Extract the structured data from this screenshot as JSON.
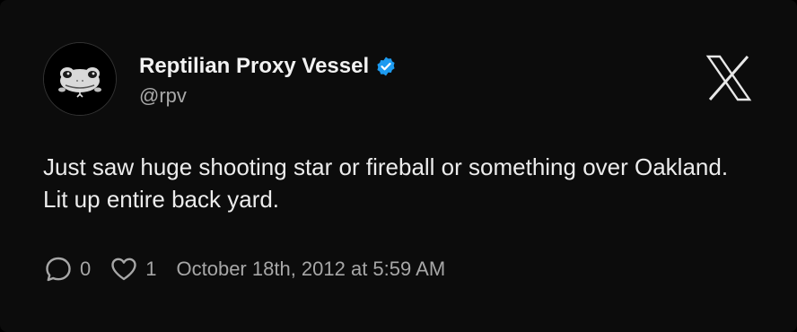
{
  "author": {
    "display_name": "Reptilian Proxy Vessel",
    "handle": "@rpv",
    "verified": true,
    "verified_color": "#1d9bf0",
    "avatar_icon": "lizard-face-icon"
  },
  "platform_logo": "x-logo-icon",
  "tweet": {
    "text": "Just saw huge shooting star or fireball or something over Oakland. Lit up entire back yard."
  },
  "stats": {
    "replies": "0",
    "likes": "1",
    "timestamp": "October 18th, 2012 at 5:59 AM"
  }
}
